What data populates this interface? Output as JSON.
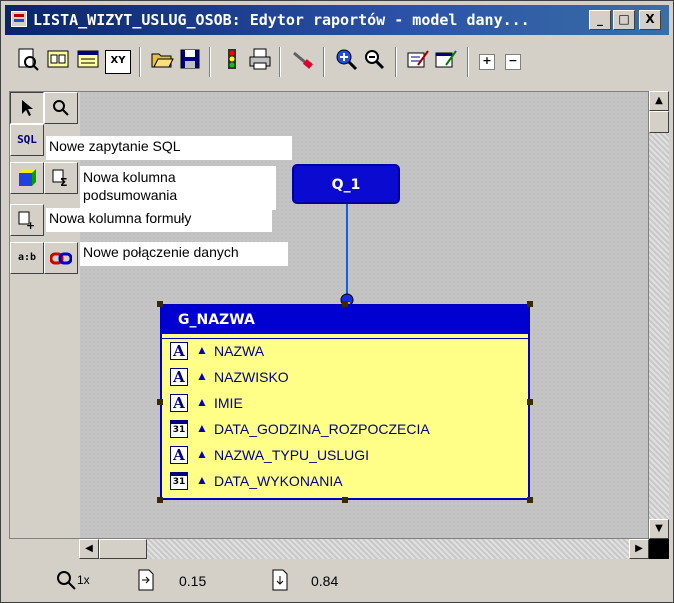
{
  "window": {
    "title": "LISTA_WIZYT_USLUG_OSOB: Edytor raportów - model dany...",
    "controls": [
      "_",
      "□",
      "X"
    ]
  },
  "toolbar": {
    "items": [
      "preview-icon",
      "data-model-icon",
      "layout-icon",
      "xy-icon",
      "open-icon",
      "save-icon",
      "run-icon",
      "print-icon",
      "paintbrush-icon",
      "zoom-in-icon",
      "zoom-out-icon",
      "edit-icon",
      "edit2-icon",
      "expand-icon",
      "collapse-icon"
    ],
    "xy_label": "XY"
  },
  "palette": {
    "sql_label": "SQL",
    "axb_label": "a:b"
  },
  "tooltips": {
    "sql": "Nowe zapytanie SQL",
    "summary_line1": "Nowa kolumna",
    "summary_line2": "podsumowania",
    "formula": "Nowa kolumna formuły",
    "link": "Nowe połączenie danych"
  },
  "query": {
    "name": "Q_1"
  },
  "group": {
    "name": "G_NAZWA",
    "fields": [
      {
        "type": "A",
        "name": "NAZWA"
      },
      {
        "type": "A",
        "name": "NAZWISKO"
      },
      {
        "type": "A",
        "name": "IMIE"
      },
      {
        "type": "31",
        "name": "DATA_GODZINA_ROZPOCZECIA"
      },
      {
        "type": "A",
        "name": "NAZWA_TYPU_USLUGI"
      },
      {
        "type": "31",
        "name": "DATA_WYKONANIA"
      }
    ]
  },
  "status": {
    "zoom": "1x",
    "x": "0.15",
    "y": "0.84"
  }
}
